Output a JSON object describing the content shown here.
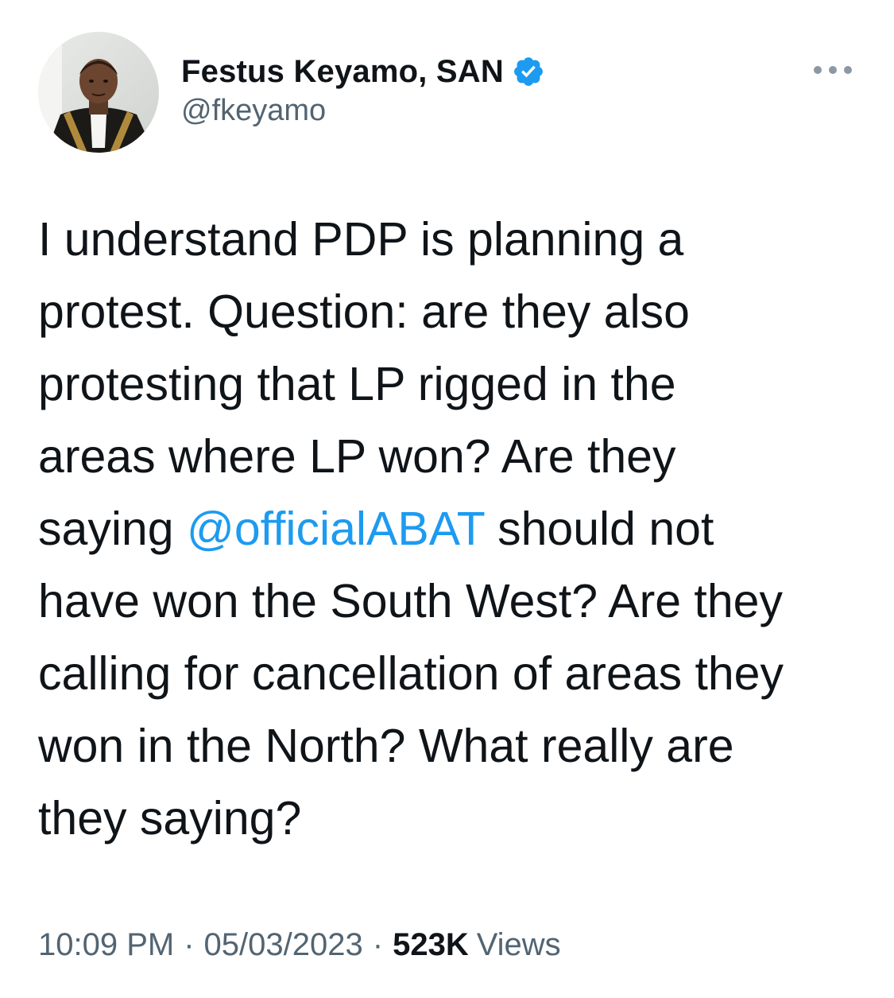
{
  "author": {
    "display_name": "Festus Keyamo, SAN",
    "handle": "@fkeyamo",
    "verified": true,
    "avatar_icon": "profile-photo"
  },
  "tweet": {
    "text_lines": [
      [
        "I understand PDP is planning a"
      ],
      [
        "protest. Question: are they also"
      ],
      [
        "protesting that LP rigged in the"
      ],
      [
        "areas where LP won? Are they"
      ],
      [
        "saying ",
        "@officialABAT",
        " should not"
      ],
      [
        "have won the South West? Are they"
      ],
      [
        "calling for cancellation of areas they"
      ],
      [
        "won in the North? What really are"
      ],
      [
        "they saying?"
      ]
    ],
    "mention": "@officialABAT",
    "time": "10:09 PM",
    "separator": "·",
    "date": "05/03/2023",
    "views_count": "523K",
    "views_label": "Views"
  },
  "colors": {
    "link": "#1d9bf0",
    "text": "#0f1419",
    "secondary": "#536471",
    "verified_badge": "#1d9bf0"
  },
  "icons": {
    "more": "more-options-icon",
    "verified": "verified-badge-icon"
  }
}
